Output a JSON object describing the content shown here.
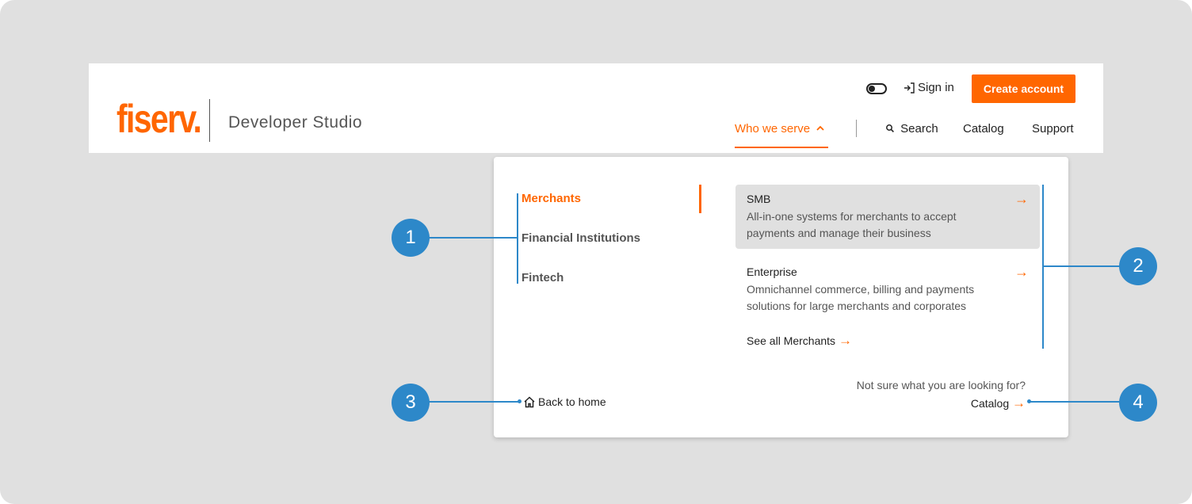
{
  "header": {
    "logo_text": "fiserv.",
    "product_name": "Developer Studio",
    "theme_toggle_icon": "toggle-icon",
    "sign_in_label": "Sign in",
    "create_account_label": "Create account",
    "nav": {
      "who_we_serve": "Who we serve",
      "search": "Search",
      "catalog": "Catalog",
      "support": "Support"
    }
  },
  "dropdown": {
    "categories": [
      {
        "label": "Merchants",
        "active": true
      },
      {
        "label": "Financial Institutions",
        "active": false
      },
      {
        "label": "Fintech",
        "active": false
      }
    ],
    "cards": [
      {
        "title": "SMB",
        "description": "All-in-one systems for merchants to accept payments and manage their business",
        "highlighted": true
      },
      {
        "title": "Enterprise",
        "description": "Omnichannel commerce, billing and payments solutions for large merchants and corporates",
        "highlighted": false
      }
    ],
    "see_all_label": "See all Merchants",
    "back_home_label": "Back to home",
    "not_sure_text": "Not sure what you are looking for?",
    "catalog_link_label": "Catalog"
  },
  "annotations": [
    "1",
    "2",
    "3",
    "4"
  ],
  "colors": {
    "accent": "#ff6600",
    "annotation": "#2d88c9",
    "background": "#e0e0e0"
  }
}
